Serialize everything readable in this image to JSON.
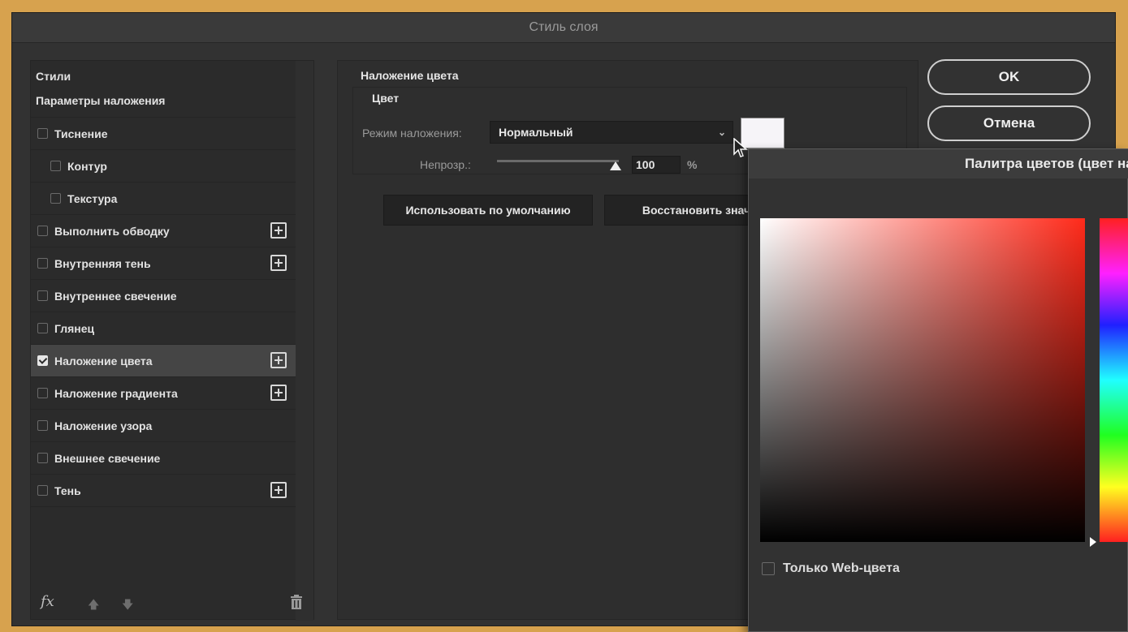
{
  "dialog": {
    "title": "Стиль слоя"
  },
  "styles_panel": {
    "header_styles": "Стили",
    "header_blend": "Параметры наложения",
    "items": [
      {
        "label": "Тиснение",
        "checked": false,
        "indent": false,
        "plus": false
      },
      {
        "label": "Контур",
        "checked": false,
        "indent": true,
        "plus": false
      },
      {
        "label": "Текстура",
        "checked": false,
        "indent": true,
        "plus": false
      },
      {
        "label": "Выполнить обводку",
        "checked": false,
        "indent": false,
        "plus": true
      },
      {
        "label": "Внутренняя тень",
        "checked": false,
        "indent": false,
        "plus": true
      },
      {
        "label": "Внутреннее свечение",
        "checked": false,
        "indent": false,
        "plus": false
      },
      {
        "label": "Глянец",
        "checked": false,
        "indent": false,
        "plus": false
      },
      {
        "label": "Наложение цвета",
        "checked": true,
        "indent": false,
        "plus": true,
        "selected": true
      },
      {
        "label": "Наложение градиента",
        "checked": false,
        "indent": false,
        "plus": true
      },
      {
        "label": "Наложение узора",
        "checked": false,
        "indent": false,
        "plus": false
      },
      {
        "label": "Внешнее свечение",
        "checked": false,
        "indent": false,
        "plus": false
      },
      {
        "label": "Тень",
        "checked": false,
        "indent": false,
        "plus": true
      }
    ],
    "fx_label": "fx"
  },
  "settings": {
    "section_title": "Наложение цвета",
    "group_title": "Цвет",
    "blend_mode_label": "Режим наложения:",
    "blend_mode_value": "Нормальный",
    "opacity_label": "Непрозр.:",
    "opacity_value": "100",
    "opacity_unit": "%",
    "opacity_level": 1.0,
    "swatch_color": "#f6f4f8",
    "default_button": "Использовать по умолчанию",
    "restore_button": "Восстановить значения"
  },
  "buttons": {
    "ok": "OK",
    "cancel": "Отмена"
  },
  "color_picker": {
    "title": "Палитра цветов (цвет наложения)",
    "hue_color": "#ff2a1a",
    "web_only_label": "Только Web-цвета",
    "web_only_checked": false
  }
}
